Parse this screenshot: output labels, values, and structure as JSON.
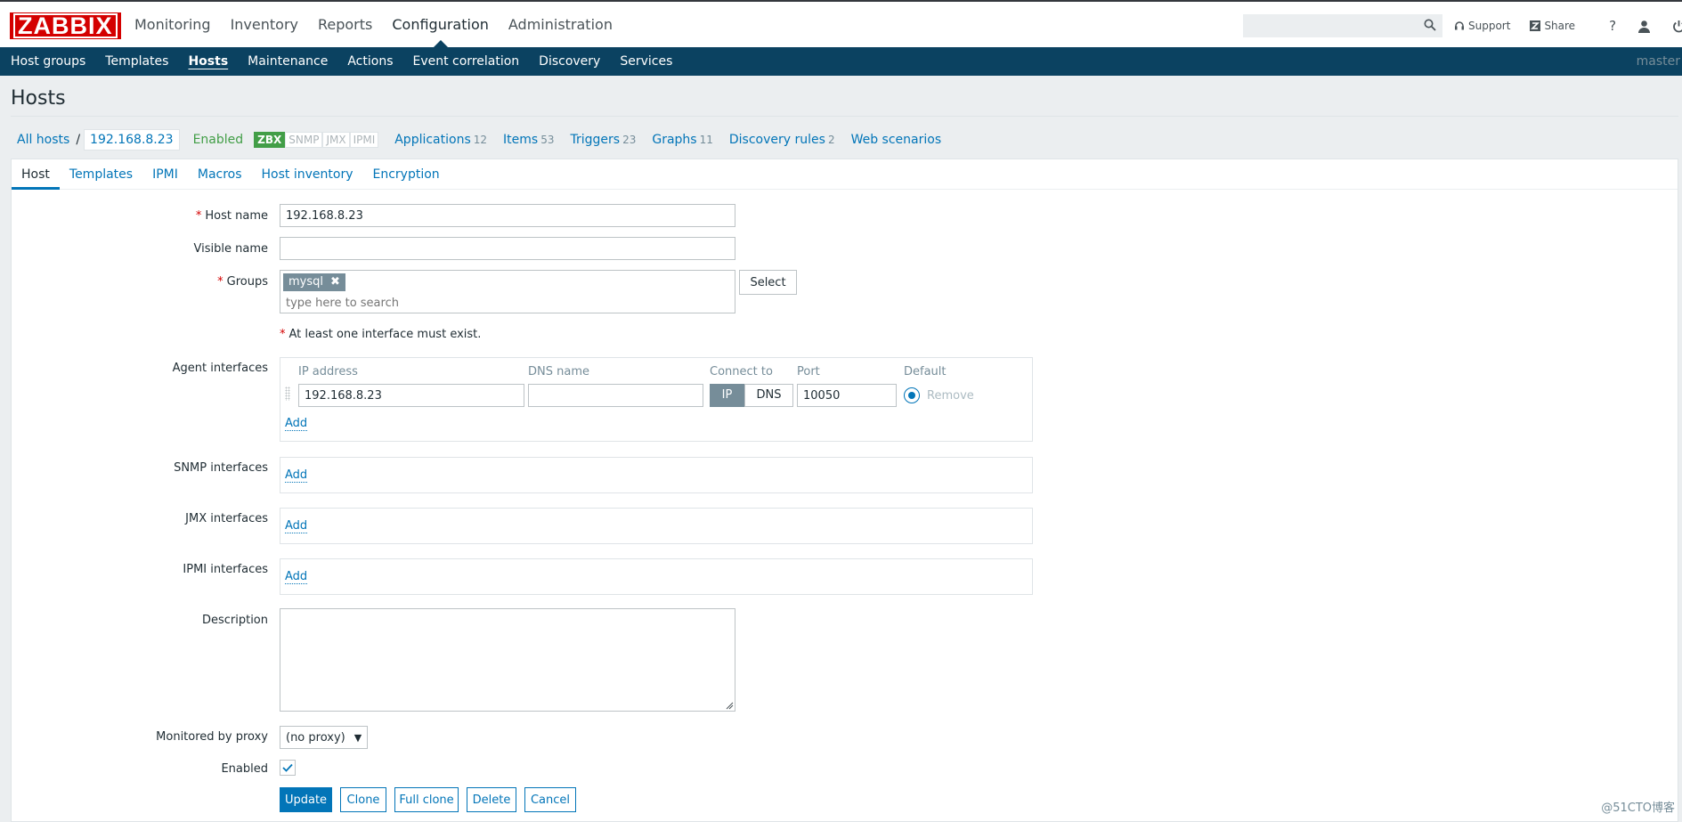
{
  "logo": {
    "text": "ZABBIX"
  },
  "main_menu": [
    {
      "label": "Monitoring"
    },
    {
      "label": "Inventory"
    },
    {
      "label": "Reports"
    },
    {
      "label": "Configuration"
    },
    {
      "label": "Administration"
    }
  ],
  "header": {
    "search_value": "",
    "support_label": "Support",
    "share_label": "Share",
    "help_glyph": "?"
  },
  "sub_menu": [
    {
      "label": "Host groups"
    },
    {
      "label": "Templates"
    },
    {
      "label": "Hosts"
    },
    {
      "label": "Maintenance"
    },
    {
      "label": "Actions"
    },
    {
      "label": "Event correlation"
    },
    {
      "label": "Discovery"
    },
    {
      "label": "Services"
    }
  ],
  "server_name": "master",
  "page_title": "Hosts",
  "breadcrumb": {
    "all_hosts": "All hosts",
    "separator": "/",
    "current": "192.168.8.23",
    "status": "Enabled",
    "interfaces": [
      "ZBX",
      "SNMP",
      "JMX",
      "IPMI"
    ],
    "links": [
      {
        "label": "Applications",
        "count": "12"
      },
      {
        "label": "Items",
        "count": "53"
      },
      {
        "label": "Triggers",
        "count": "23"
      },
      {
        "label": "Graphs",
        "count": "11"
      },
      {
        "label": "Discovery rules",
        "count": "2"
      },
      {
        "label": "Web scenarios",
        "count": ""
      }
    ]
  },
  "tabs": [
    {
      "label": "Host"
    },
    {
      "label": "Templates"
    },
    {
      "label": "IPMI"
    },
    {
      "label": "Macros"
    },
    {
      "label": "Host inventory"
    },
    {
      "label": "Encryption"
    }
  ],
  "form": {
    "required_mark": "*",
    "host_name_label": "Host name",
    "host_name_value": "192.168.8.23",
    "visible_name_label": "Visible name",
    "visible_name_value": "",
    "groups_label": "Groups",
    "group_chip": "mysql",
    "groups_placeholder": "type here to search",
    "select_label": "Select",
    "interface_hint": "At least one interface must exist.",
    "agent_interfaces_label": "Agent interfaces",
    "columns": {
      "ip": "IP address",
      "dns": "DNS name",
      "connect": "Connect to",
      "port": "Port",
      "default": "Default"
    },
    "agent_row": {
      "ip": "192.168.8.23",
      "dns": "",
      "connect_ip": "IP",
      "connect_dns": "DNS",
      "port": "10050",
      "remove": "Remove"
    },
    "add_label": "Add",
    "snmp_interfaces_label": "SNMP interfaces",
    "jmx_interfaces_label": "JMX interfaces",
    "ipmi_interfaces_label": "IPMI interfaces",
    "description_label": "Description",
    "description_value": "",
    "proxy_label": "Monitored by proxy",
    "proxy_value": "(no proxy)",
    "enabled_label": "Enabled",
    "buttons": {
      "update": "Update",
      "clone": "Clone",
      "full_clone": "Full clone",
      "delete": "Delete",
      "cancel": "Cancel"
    }
  },
  "watermark": "@51CTO博客",
  "colors": {
    "brand_red": "#d40000",
    "nav_blue": "#0b4261",
    "link_blue": "#0275b8",
    "enabled_green": "#429e47"
  }
}
